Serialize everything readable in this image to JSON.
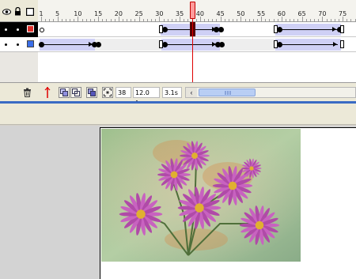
{
  "timeline": {
    "ruler_labels": [
      "1",
      "5",
      "10",
      "15",
      "20",
      "25",
      "30",
      "35",
      "40",
      "45",
      "50",
      "55",
      "60",
      "65",
      "70",
      "75"
    ],
    "current_frame": "38",
    "frame_rate": "12.0 fps",
    "elapsed_time": "3.1s",
    "layers": [
      {
        "color": "#e0302c"
      },
      {
        "color": "#3a6ee8"
      }
    ]
  },
  "toolbar_icons": [
    "trash-icon",
    "onion-skin-icon",
    "onion-skin-outline-icon",
    "edit-multiple-frames-icon",
    "modify-onion-markers-icon",
    "center-frame-icon"
  ],
  "colors": {
    "tween_fill": "#cfd0f5",
    "playhead": "#e00000",
    "selection_bar": "#3a6bc4"
  }
}
